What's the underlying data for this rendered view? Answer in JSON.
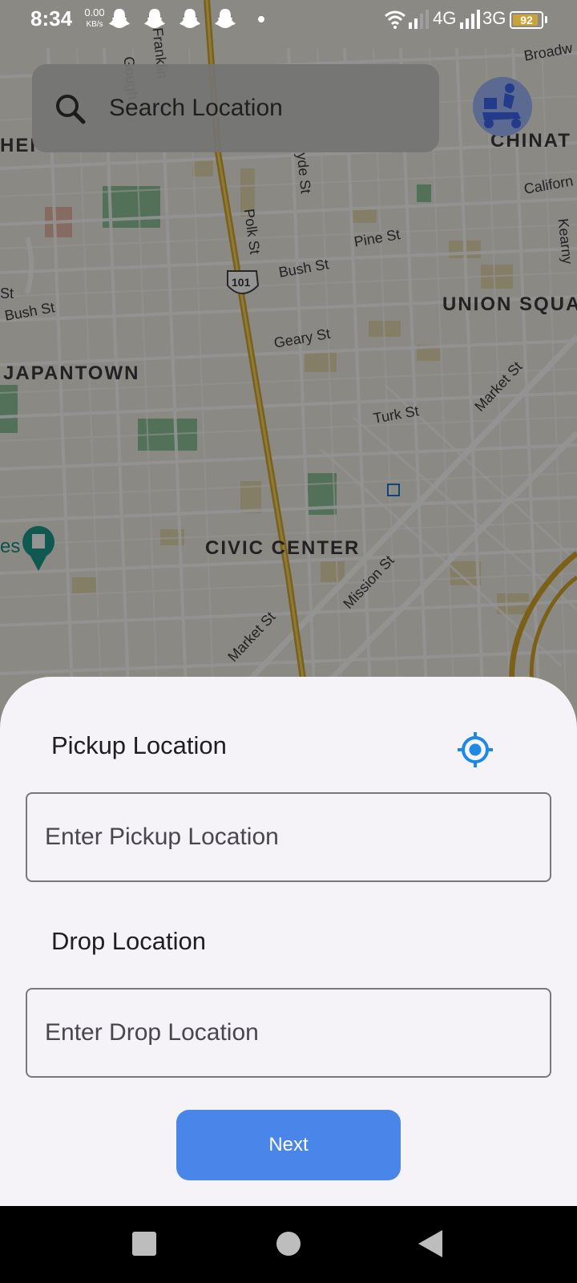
{
  "status_bar": {
    "time": "8:34",
    "speed_value": "0.00",
    "speed_unit": "KB/s",
    "icons": [
      "snapchat-icon",
      "snapchat-icon",
      "snapchat-icon",
      "snapchat-icon",
      "dot-icon",
      "wifi-icon",
      "signal-icon",
      "signal-icon"
    ],
    "network_1": "4G",
    "network_2": "3G",
    "battery_level": 92,
    "battery_text": "92"
  },
  "map": {
    "districts": {
      "chinatown": "CHINAT",
      "union_square": "UNION SQUA",
      "japantown": "JAPANTOWN",
      "civic_center": "CIVIC CENTER",
      "left_partial": "HEI"
    },
    "streets": {
      "broadway": "Broadw",
      "gough": "Gough",
      "franklin": "Franklin",
      "hyde": "yde St",
      "polk": "Polk St",
      "pine": "Pine St",
      "bush_1": "Bush St",
      "bush_2": "Bush St",
      "california": "Californ",
      "kearny": "Kearny",
      "geary": "Geary St",
      "turk": "Turk St",
      "market_1": "Market St",
      "market_2": "Market St",
      "mission": "Mission St",
      "highway": "101",
      "es": "es",
      "st": "St"
    }
  },
  "search": {
    "placeholder": "Search Location",
    "icon": "search-icon"
  },
  "sheet": {
    "pickup_label": "Pickup Location",
    "pickup_placeholder": "Enter Pickup Location",
    "drop_label": "Drop Location",
    "drop_placeholder": "Enter Drop Location",
    "next_label": "Next",
    "locate_icon": "my-location-icon"
  },
  "colors": {
    "accent": "#4a86ea",
    "locate": "#1e88e5",
    "sheet_bg": "#f5f2f8",
    "search_bg": "#747474"
  },
  "nav_bar": {
    "icons": [
      "recents-icon",
      "home-icon",
      "back-icon"
    ]
  }
}
